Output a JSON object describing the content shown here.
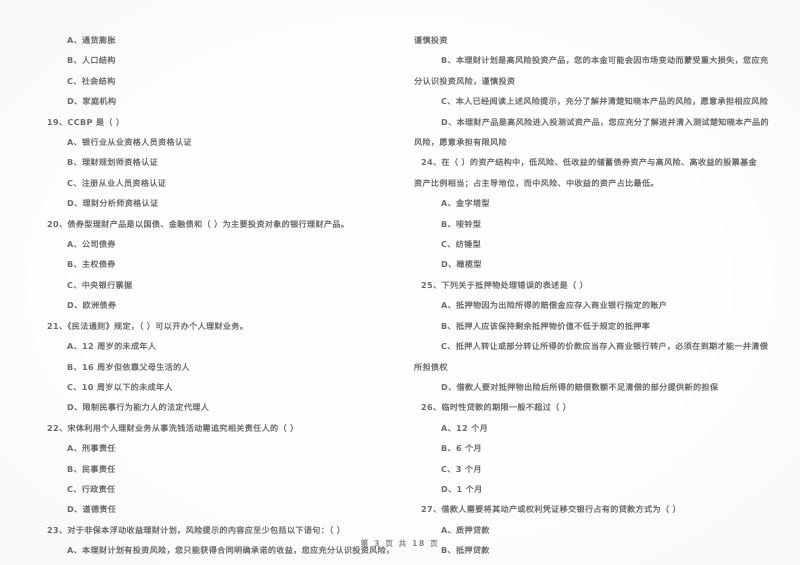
{
  "document": {
    "type": "scanned-exam-paper",
    "background_color": "#fefefe",
    "ink_color": "#606060",
    "footer": "第 3 页 共 18 页"
  },
  "left_column": {
    "lines": [
      {
        "kind": "option",
        "text": "A、通货膨胀"
      },
      {
        "kind": "option",
        "text": "B、人口结构"
      },
      {
        "kind": "option",
        "text": "C、社会结构"
      },
      {
        "kind": "option",
        "text": "D、家庭机构"
      },
      {
        "kind": "stem",
        "text": "19、CCBP 是（      ）"
      },
      {
        "kind": "option",
        "text": "A、银行业从业资格人员资格认证"
      },
      {
        "kind": "option",
        "text": "B、理财规划师资格认证"
      },
      {
        "kind": "option",
        "text": "C、注册从业人员资格认证"
      },
      {
        "kind": "option",
        "text": "D、理财分析师资格认证"
      },
      {
        "kind": "stem",
        "text": "20、债券型理财产品是以国债、金融债和（      ）为主要投资对象的银行理财产品。"
      },
      {
        "kind": "option",
        "text": "A、公司债券"
      },
      {
        "kind": "option",
        "text": "B、主权债券"
      },
      {
        "kind": "option",
        "text": "C、中央银行票据"
      },
      {
        "kind": "option",
        "text": "D、欧洲债券"
      },
      {
        "kind": "stem",
        "text": "21、《民法通则》规定，（      ）可以开办个人理财业务。"
      },
      {
        "kind": "option",
        "text": "A、12 周岁的未成年人"
      },
      {
        "kind": "option",
        "text": "B、16 周岁但依靠父母生活的人"
      },
      {
        "kind": "option",
        "text": "C、10 周岁以下的未成年人"
      },
      {
        "kind": "option",
        "text": "D、限制民事行为能力人的法定代理人"
      },
      {
        "kind": "stem",
        "text": "22、宋体利用个人理财业务从事洗钱活动需追究相关责任人的（      ）"
      },
      {
        "kind": "option",
        "text": "A、刑事责任"
      },
      {
        "kind": "option",
        "text": "B、民事责任"
      },
      {
        "kind": "option",
        "text": "C、行政责任"
      },
      {
        "kind": "option",
        "text": "D、道德责任"
      },
      {
        "kind": "stem",
        "text": "23、对于非保本浮动收益理财计划，风险提示的内容应至少包括以下语句：（      ）"
      },
      {
        "kind": "option",
        "text": "A、本理财计划有投资风险，您只能获得合同明确承诺的收益，您应充分认识投资风险，"
      }
    ]
  },
  "right_column": {
    "lines": [
      {
        "kind": "wrap",
        "text": "谨慎投资"
      },
      {
        "kind": "option",
        "text": "B、本理财计划是高风险投资产品，您的本金可能会因市场变动而蒙受重大损失，您应充"
      },
      {
        "kind": "wrap",
        "text": "分认识投资风险，谨慎投资"
      },
      {
        "kind": "option",
        "text": "C、本人已经阅读上述风险提示，充分了解并清楚知晓本产品的风险，愿意承担相应风险"
      },
      {
        "kind": "option",
        "text": "D、本理财产品是高风险进入投测试资产品，您应充分了解进并清入测试楚知晓本产品的"
      },
      {
        "kind": "wrap",
        "text": "风险，愿意承担有限风险"
      },
      {
        "kind": "stem",
        "text": "24、在（      ）的资产结构中，低风险、低收益的储蓄债券资产与高风险、高收益的股票基金"
      },
      {
        "kind": "wrap",
        "text": "资产比例相当；占主导地位，而中风险、中收益的资产占比最低。"
      },
      {
        "kind": "option",
        "text": "A、金字塔型"
      },
      {
        "kind": "option",
        "text": "B、哑铃型"
      },
      {
        "kind": "option",
        "text": "C、纺锤型"
      },
      {
        "kind": "option",
        "text": "D、橄榄型"
      },
      {
        "kind": "stem",
        "text": "25、下列关于抵押物处理错误的表述是（      ）"
      },
      {
        "kind": "option",
        "text": "A、抵押物因为出险所得的赔偿金应存入商业银行指定的账户"
      },
      {
        "kind": "option",
        "text": "B、抵押人应该保持剩余抵押物价值不低于规定的抵押率"
      },
      {
        "kind": "option",
        "text": "C、抵押人转让或部分转让所得的价款应当存入商业银行转户，必须在到期才能一并清偿"
      },
      {
        "kind": "wrap",
        "text": "所担债权"
      },
      {
        "kind": "option",
        "text": "D、借款人要对抵押物出险后所得的赔偿数额不足清偿的部分提供新的担保"
      },
      {
        "kind": "stem",
        "text": "26、临时性贷款的期限一般不超过（      ）"
      },
      {
        "kind": "option",
        "text": "A、12 个月"
      },
      {
        "kind": "option",
        "text": "B、6 个月"
      },
      {
        "kind": "option",
        "text": "C、3 个月"
      },
      {
        "kind": "option",
        "text": "D、1 个月"
      },
      {
        "kind": "stem",
        "text": "27、借款人需要将其动产或权利凭证移交银行占有的贷款方式为（      ）"
      },
      {
        "kind": "option",
        "text": "A、质押贷款"
      },
      {
        "kind": "option",
        "text": "B、抵押贷款"
      }
    ]
  }
}
